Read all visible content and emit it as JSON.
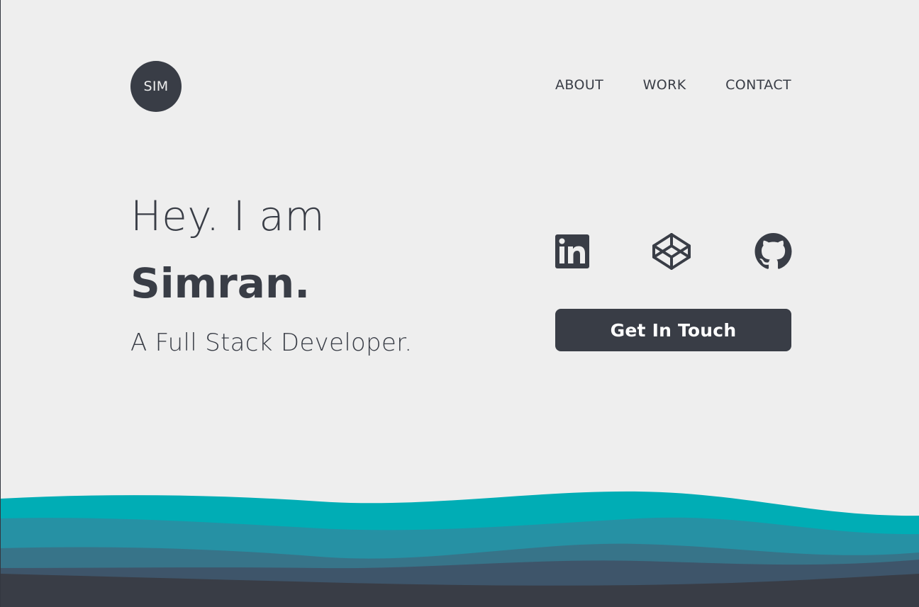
{
  "header": {
    "logo_text": "SIM",
    "nav": [
      {
        "label": "ABOUT"
      },
      {
        "label": "WORK"
      },
      {
        "label": "CONTACT"
      }
    ]
  },
  "hero": {
    "greeting": "Hey. I am",
    "name": "Simran.",
    "tagline": "A Full Stack Developer."
  },
  "social": [
    {
      "icon": "linkedin-icon"
    },
    {
      "icon": "codepen-icon"
    },
    {
      "icon": "github-icon"
    }
  ],
  "cta": {
    "label": "Get In Touch"
  },
  "colors": {
    "background": "#eeeeee",
    "text": "#393d46",
    "wave_1": "#00adb5",
    "wave_2": "#2691a4",
    "wave_3": "#377489",
    "wave_4": "#3e556a",
    "wave_5": "#393d46"
  }
}
